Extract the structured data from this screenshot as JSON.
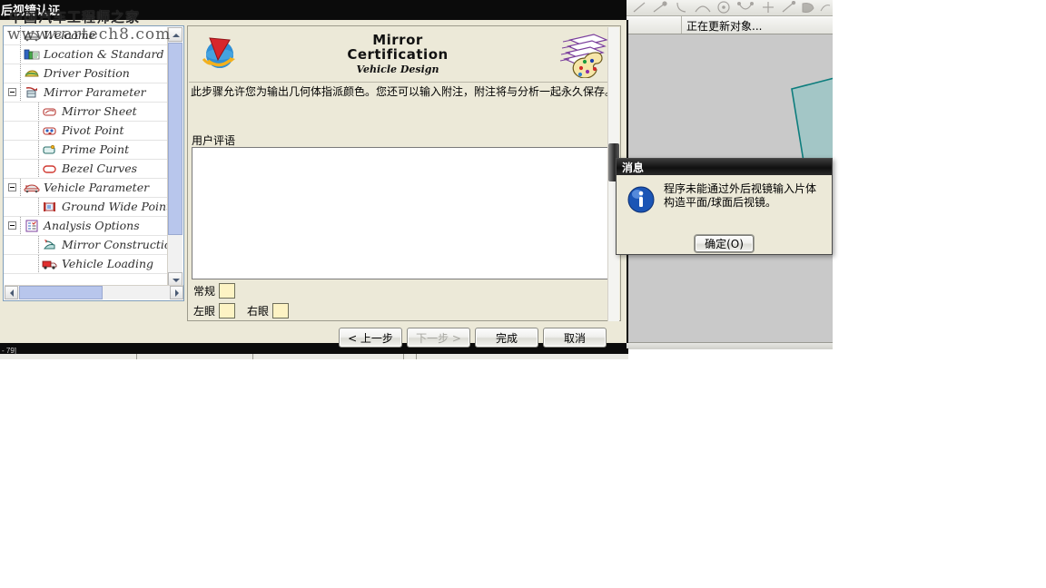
{
  "window": {
    "title": "后视镜认证"
  },
  "watermark": {
    "line1": "中国汽车工程师之家",
    "line2": "www.cartech8.com"
  },
  "cad": {
    "status_text": "正在更新对象...",
    "toolbar_icons": [
      "line-icon",
      "point-curve-icon",
      "arc-icon",
      "spline-icon",
      "circle-icon",
      "arc-fillet-icon",
      "plus-icon",
      "tangent-line-icon",
      "surface-icon",
      "sweep-icon"
    ]
  },
  "banner": {
    "title_line1": "Mirror",
    "title_line2": "Certification",
    "subtitle": "Vehicle Design",
    "left_icon": "globe-arrow-icon",
    "right_icon": "palette-sheets-icon"
  },
  "content": {
    "description": "此步骤允许您为输出几何体指派颜色。您还可以输入附注，附注将与分析一起永久保存。",
    "comments_label": "用户评语",
    "comments_value": "",
    "comments_placeholder": ""
  },
  "colors": {
    "swatch_fill": "#fdf3c4",
    "general_label": "常规",
    "left_eye_label": "左眼",
    "right_eye_label": "右眼"
  },
  "tree": {
    "items": [
      {
        "label": "Welcome",
        "icon": "car-front-icon",
        "depth": 1,
        "expander": false
      },
      {
        "label": "Location & Standard",
        "icon": "book-standard-icon",
        "depth": 1,
        "expander": false
      },
      {
        "label": "Driver Position",
        "icon": "driver-seat-icon",
        "depth": 1,
        "expander": false
      },
      {
        "label": "Mirror Parameter",
        "icon": "mirror-param-icon",
        "depth": 1,
        "expander": true
      },
      {
        "label": "Mirror Sheet",
        "icon": "mirror-sheet-icon",
        "depth": 2,
        "expander": false
      },
      {
        "label": "Pivot Point",
        "icon": "pivot-point-icon",
        "depth": 2,
        "expander": false
      },
      {
        "label": "Prime Point",
        "icon": "prime-point-icon",
        "depth": 2,
        "expander": false
      },
      {
        "label": "Bezel Curves",
        "icon": "bezel-curve-icon",
        "depth": 2,
        "expander": false
      },
      {
        "label": "Vehicle Parameter",
        "icon": "vehicle-param-icon",
        "depth": 1,
        "expander": true
      },
      {
        "label": "Ground Wide Point",
        "icon": "ground-point-icon",
        "depth": 2,
        "expander": false
      },
      {
        "label": "Analysis Options",
        "icon": "analysis-options-icon",
        "depth": 1,
        "expander": true
      },
      {
        "label": "Mirror Construction & D",
        "icon": "mirror-construct-icon",
        "depth": 2,
        "expander": false
      },
      {
        "label": "Vehicle Loading",
        "icon": "vehicle-loading-icon",
        "depth": 2,
        "expander": false
      }
    ]
  },
  "buttons": {
    "back": "< 上一步",
    "next": "下一步 >",
    "finish": "完成",
    "cancel": "取消"
  },
  "dialog": {
    "title": "消息",
    "message": "程序未能通过外后视镜输入片体构造平面/球面后视镜。",
    "ok_label": "确定(O)",
    "icon": "info-icon"
  }
}
